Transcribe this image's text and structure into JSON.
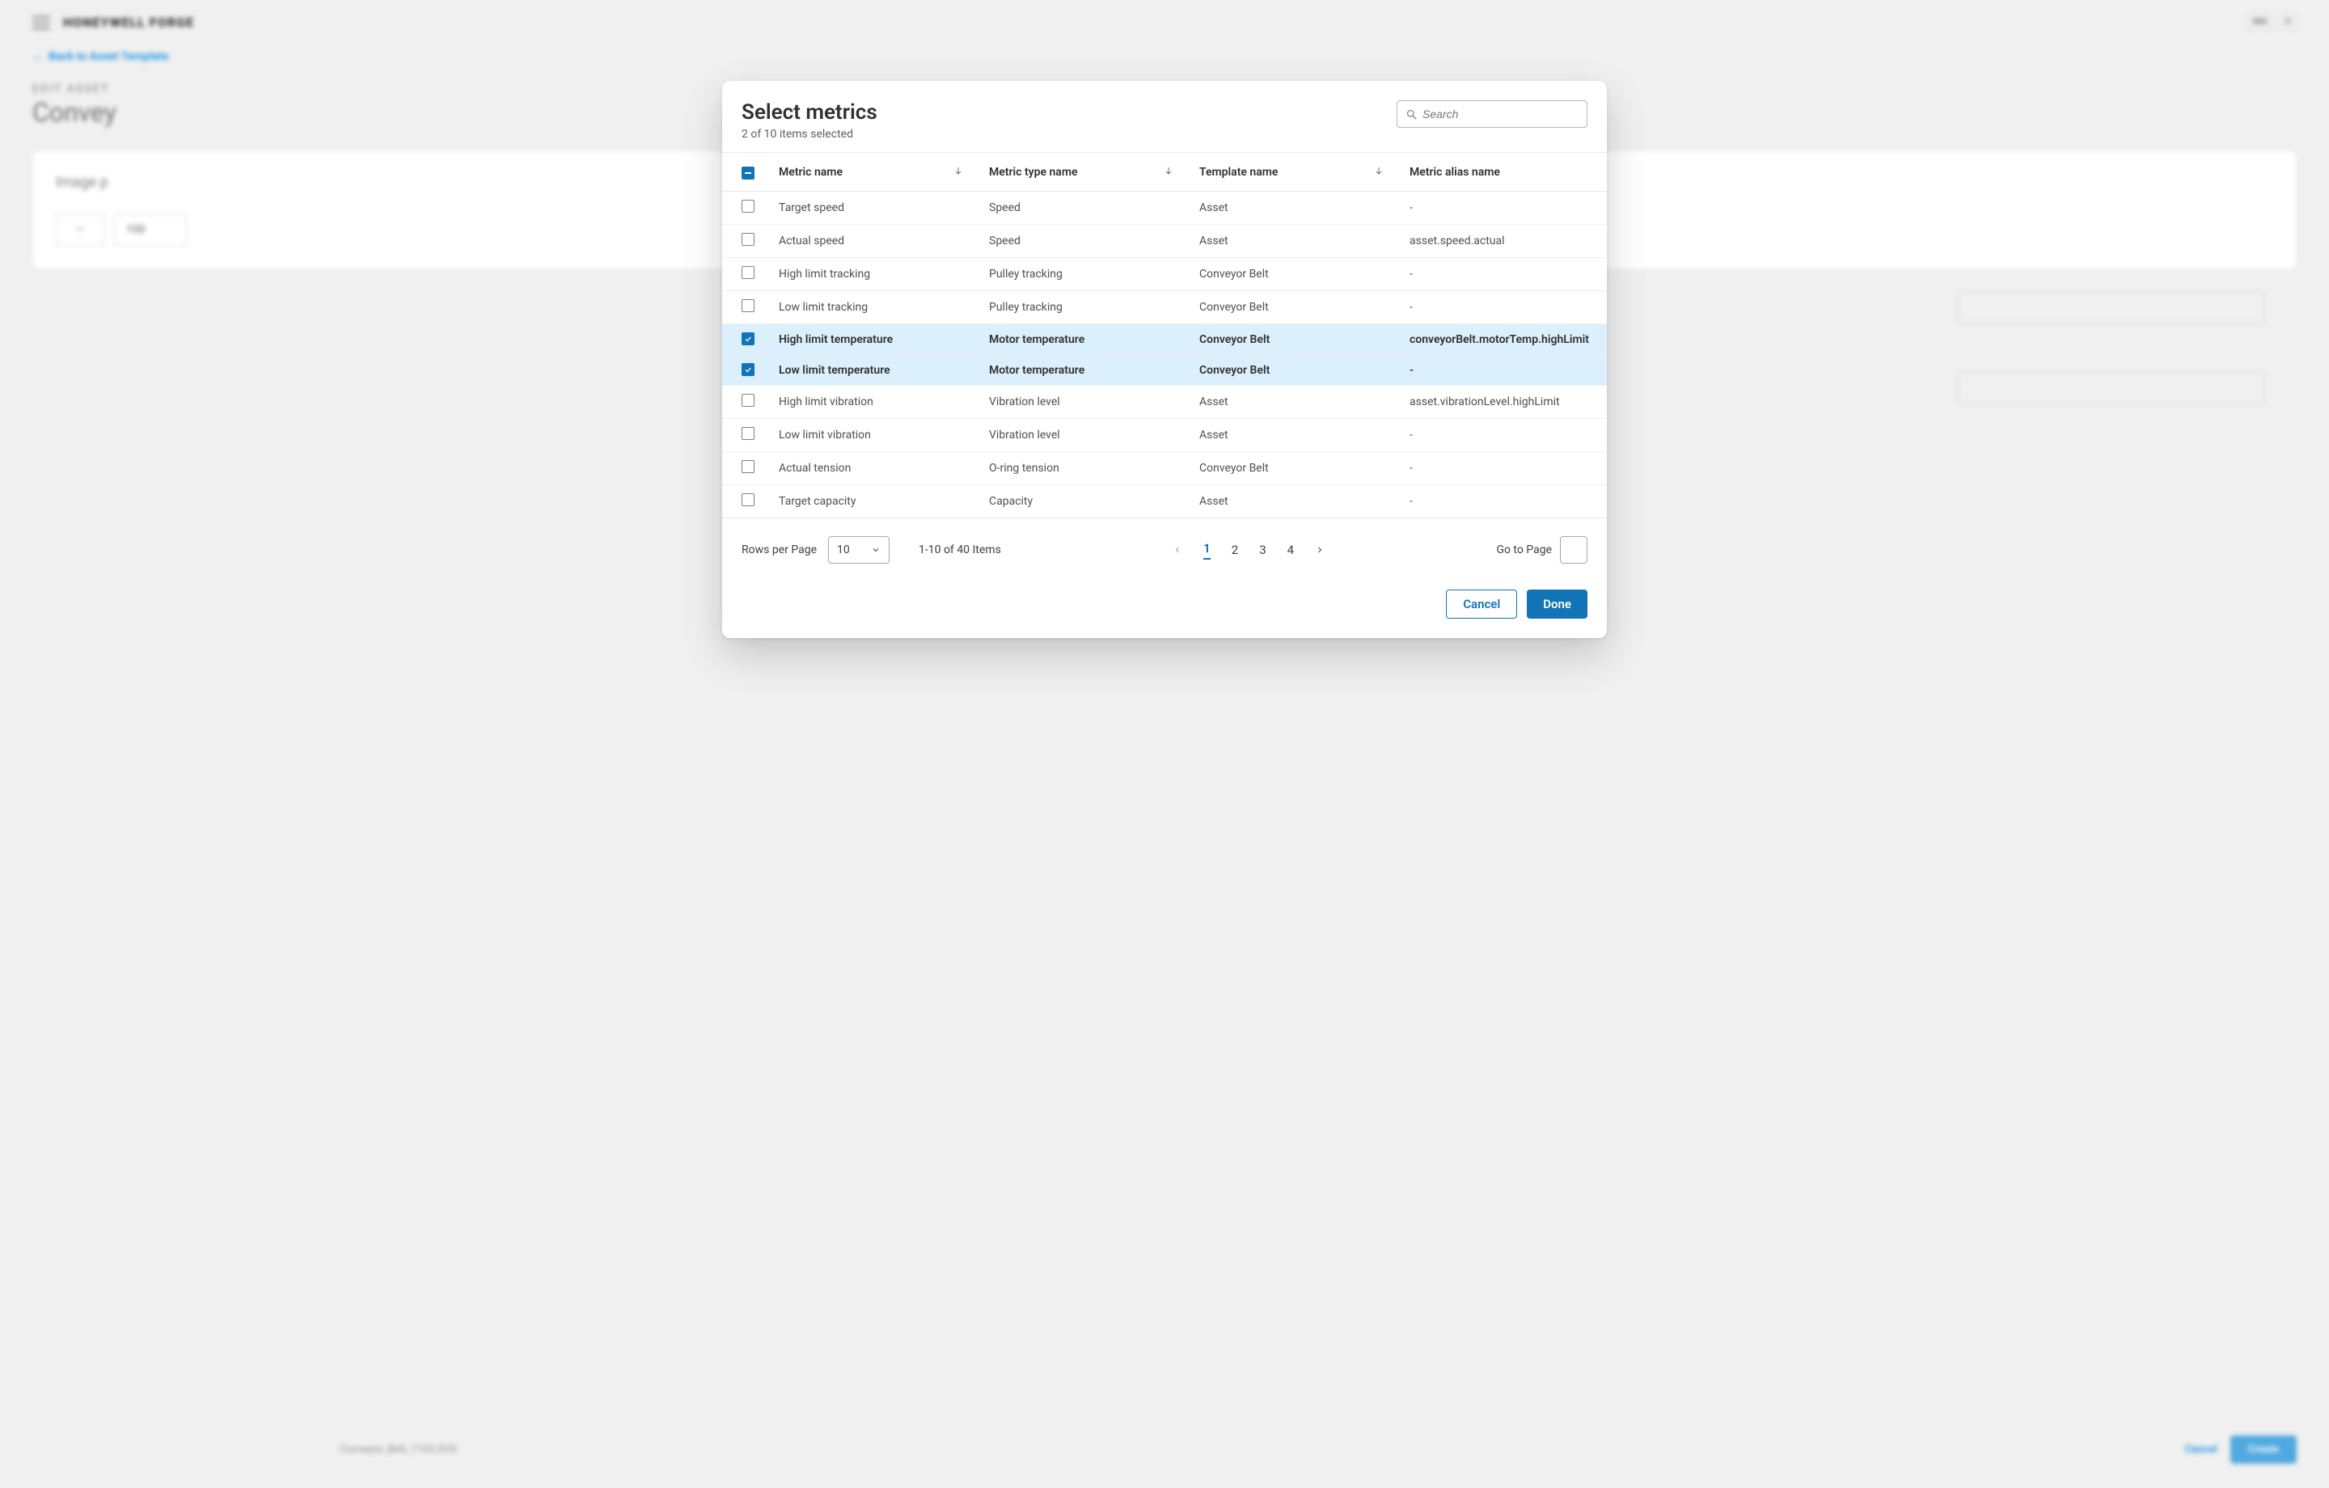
{
  "background": {
    "brand": "HONEYWELL FORGE",
    "avatar_initials": "MM",
    "power_glyph": "⏻",
    "back_link": "Back to Asset Template",
    "eyebrow": "EDIT ASSET",
    "title_prefix": "Convey",
    "card_label": "Image p",
    "slot_small": "—",
    "slot_val": "100",
    "footer_filename": "Conveyor_Belt_1103.SVG",
    "footer_cancel": "Cancel",
    "footer_create": "Create"
  },
  "modal": {
    "title": "Select metrics",
    "subtitle": "2 of 10 items selected",
    "search_placeholder": "Search",
    "columns": {
      "c1": "Metric name",
      "c2": "Metric type name",
      "c3": "Template name",
      "c4": "Metric alias name"
    },
    "rows": [
      {
        "selected": false,
        "name": "Target speed",
        "type": "Speed",
        "template": "Asset",
        "alias": "-"
      },
      {
        "selected": false,
        "name": "Actual speed",
        "type": "Speed",
        "template": "Asset",
        "alias": "asset.speed.actual"
      },
      {
        "selected": false,
        "name": "High limit tracking",
        "type": "Pulley tracking",
        "template": "Conveyor Belt",
        "alias": "-"
      },
      {
        "selected": false,
        "name": "Low limit tracking",
        "type": "Pulley tracking",
        "template": "Conveyor Belt",
        "alias": "-"
      },
      {
        "selected": true,
        "name": "High limit temperature",
        "type": "Motor temperature",
        "template": "Conveyor Belt",
        "alias": "conveyorBelt.motorTemp.highLimit"
      },
      {
        "selected": true,
        "name": "Low limit temperature",
        "type": "Motor temperature",
        "template": "Conveyor Belt",
        "alias": "-"
      },
      {
        "selected": false,
        "name": "High limit vibration",
        "type": "Vibration level",
        "template": "Asset",
        "alias": "asset.vibrationLevel.highLimit"
      },
      {
        "selected": false,
        "name": "Low limit vibration",
        "type": "Vibration level",
        "template": "Asset",
        "alias": "-"
      },
      {
        "selected": false,
        "name": "Actual tension",
        "type": "O-ring tension",
        "template": "Conveyor Belt",
        "alias": "-"
      },
      {
        "selected": false,
        "name": "Target capacity",
        "type": "Capacity",
        "template": "Asset",
        "alias": "-"
      }
    ],
    "pagination": {
      "rows_per_page_label": "Rows per Page",
      "rows_per_page_value": "10",
      "range_text": "1-10 of 40 Items",
      "pages": [
        "1",
        "2",
        "3",
        "4"
      ],
      "active_page_index": 0,
      "goto_label": "Go to Page"
    },
    "buttons": {
      "cancel": "Cancel",
      "done": "Done"
    }
  }
}
